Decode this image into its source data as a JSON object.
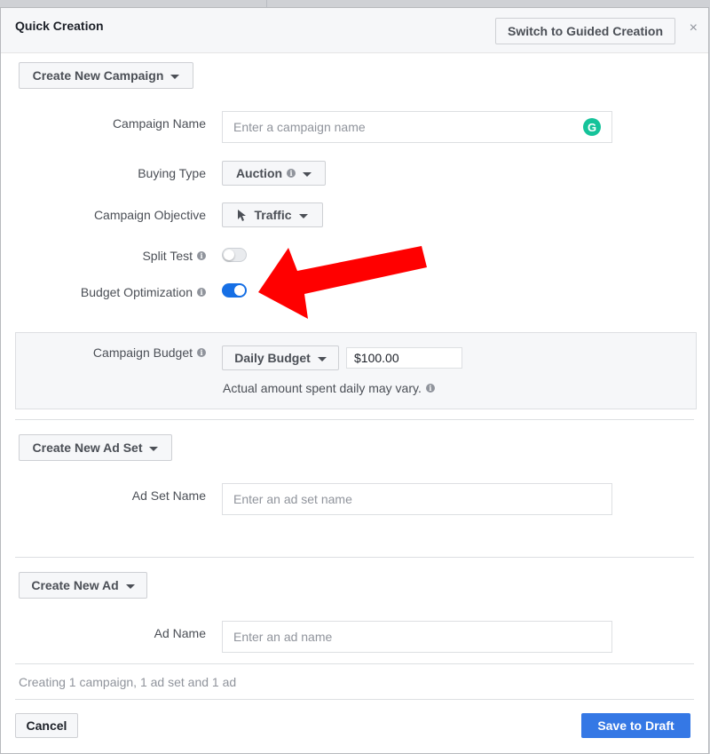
{
  "dialog": {
    "title": "Quick Creation",
    "switch_label": "Switch to Guided Creation",
    "close_symbol": "×"
  },
  "campaign": {
    "create_label": "Create New Campaign",
    "name_label": "Campaign Name",
    "name_placeholder": "Enter a campaign name",
    "buying_type_label": "Buying Type",
    "buying_type_value": "Auction",
    "objective_label": "Campaign Objective",
    "objective_value": "Traffic",
    "split_test_label": "Split Test",
    "split_test_on": false,
    "budget_opt_label": "Budget Optimization",
    "budget_opt_on": true
  },
  "budget": {
    "label": "Campaign Budget",
    "type_value": "Daily Budget",
    "amount_value": "$100.00",
    "note": "Actual amount spent daily may vary."
  },
  "ad_set": {
    "create_label": "Create New Ad Set",
    "name_label": "Ad Set Name",
    "name_placeholder": "Enter an ad set name"
  },
  "ad": {
    "create_label": "Create New Ad",
    "name_label": "Ad Name",
    "name_placeholder": "Enter an ad name"
  },
  "footer": {
    "status": "Creating 1 campaign, 1 ad set and 1 ad",
    "cancel_label": "Cancel",
    "save_label": "Save to Draft"
  },
  "icons": {
    "info": "info-icon",
    "cursor": "cursor-icon",
    "grammarly": "grammarly-icon",
    "annotation_arrow": "red-arrow"
  },
  "colors": {
    "primary": "#3578e5",
    "toggle_on": "#166fe5",
    "arrow": "#ff0000",
    "grammarly": "#15c39a"
  }
}
